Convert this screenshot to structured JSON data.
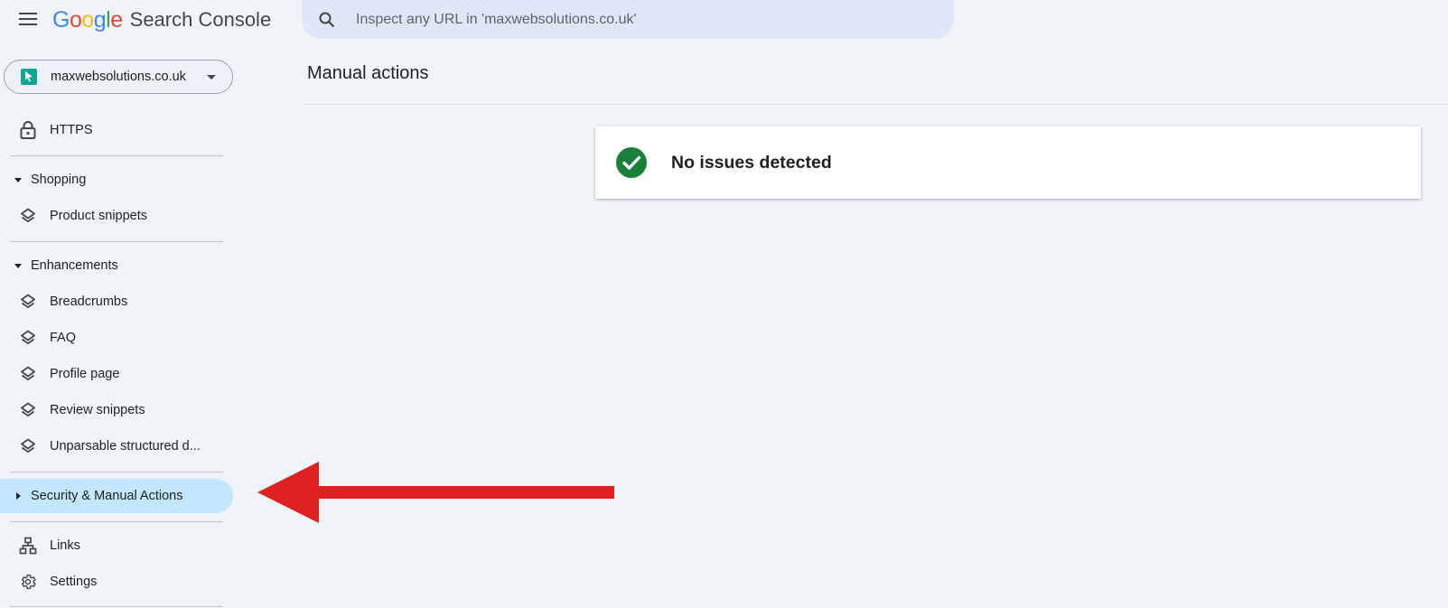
{
  "header": {
    "menu_icon": "hamburger-menu-icon",
    "logo_google": "Google",
    "logo_product": "Search Console",
    "search_placeholder": "Inspect any URL in 'maxwebsolutions.co.uk'",
    "search_icon": "search-icon"
  },
  "property": {
    "name": "maxwebsolutions.co.uk",
    "favicon_color": "#12a594"
  },
  "sidebar": {
    "https": {
      "label": "HTTPS",
      "icon": "lock-icon"
    },
    "shopping": {
      "label": "Shopping",
      "items": [
        {
          "label": "Product snippets",
          "icon": "layers-icon"
        }
      ]
    },
    "enhancements": {
      "label": "Enhancements",
      "items": [
        {
          "label": "Breadcrumbs",
          "icon": "layers-icon"
        },
        {
          "label": "FAQ",
          "icon": "layers-icon"
        },
        {
          "label": "Profile page",
          "icon": "layers-icon"
        },
        {
          "label": "Review snippets",
          "icon": "layers-icon"
        },
        {
          "label": "Unparsable structured d...",
          "icon": "layers-icon"
        }
      ]
    },
    "security": {
      "label": "Security & Manual Actions",
      "expanded": false,
      "selected": true
    },
    "links": {
      "label": "Links",
      "icon": "sitemap-icon"
    },
    "settings": {
      "label": "Settings",
      "icon": "gear-icon"
    }
  },
  "main": {
    "title": "Manual actions",
    "status": {
      "message": "No issues detected",
      "icon": "check-circle-icon",
      "color": "#188038"
    }
  },
  "annotation": {
    "type": "red-arrow",
    "color": "#e02020",
    "points_to": "Security & Manual Actions"
  },
  "colors": {
    "background": "#f0f4f9",
    "selected_nav": "#c2e7ff",
    "search_bg": "#dfe8f7"
  }
}
